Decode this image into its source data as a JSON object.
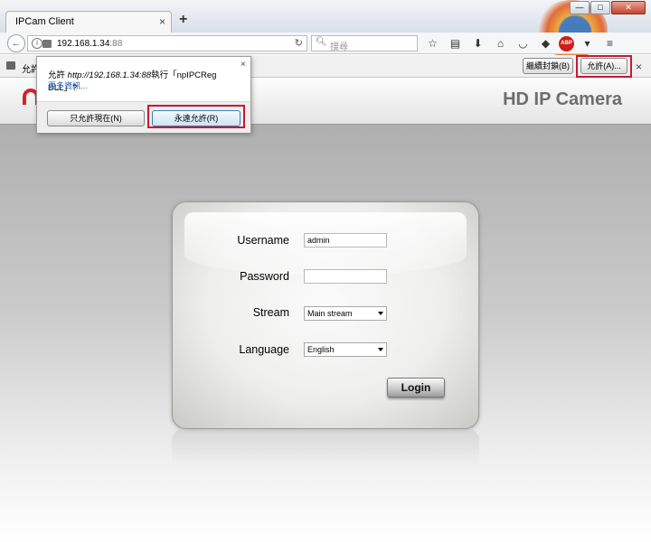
{
  "browser": {
    "tab_title": "IPCam Client",
    "tab_close": "×",
    "new_tab": "+",
    "url_host": "192.168.1.34",
    "url_port": ":88",
    "search_placeholder": "搜尋",
    "abp_label": "ABP",
    "window_buttons": {
      "minimize": "—",
      "maximize": "□",
      "close": "✕"
    }
  },
  "notification_bar": {
    "text": "允許",
    "continue_blocking_label": "繼續封鎖(B)",
    "allow_label": "允許(A)...",
    "close": "×"
  },
  "plugin_popup": {
    "prefix": "允許",
    "url": "http://192.168.1.34:88",
    "middle": "執行「npIPCReg DLL」?",
    "learn_more": "更多資訊...",
    "close": "×",
    "allow_now_label": "只允許現在(N)",
    "allow_always_label": "永遠允許(R)"
  },
  "page": {
    "title": "HD IP Camera"
  },
  "login": {
    "username_label": "Username",
    "username_value": "admin",
    "password_label": "Password",
    "password_value": "",
    "stream_label": "Stream",
    "stream_value": "Main stream",
    "language_label": "Language",
    "language_value": "English",
    "login_button": "Login"
  },
  "colors": {
    "highlight_red": "#c9192f",
    "page_title_gray": "#6e6e6e",
    "logo_red": "#d2232a"
  }
}
